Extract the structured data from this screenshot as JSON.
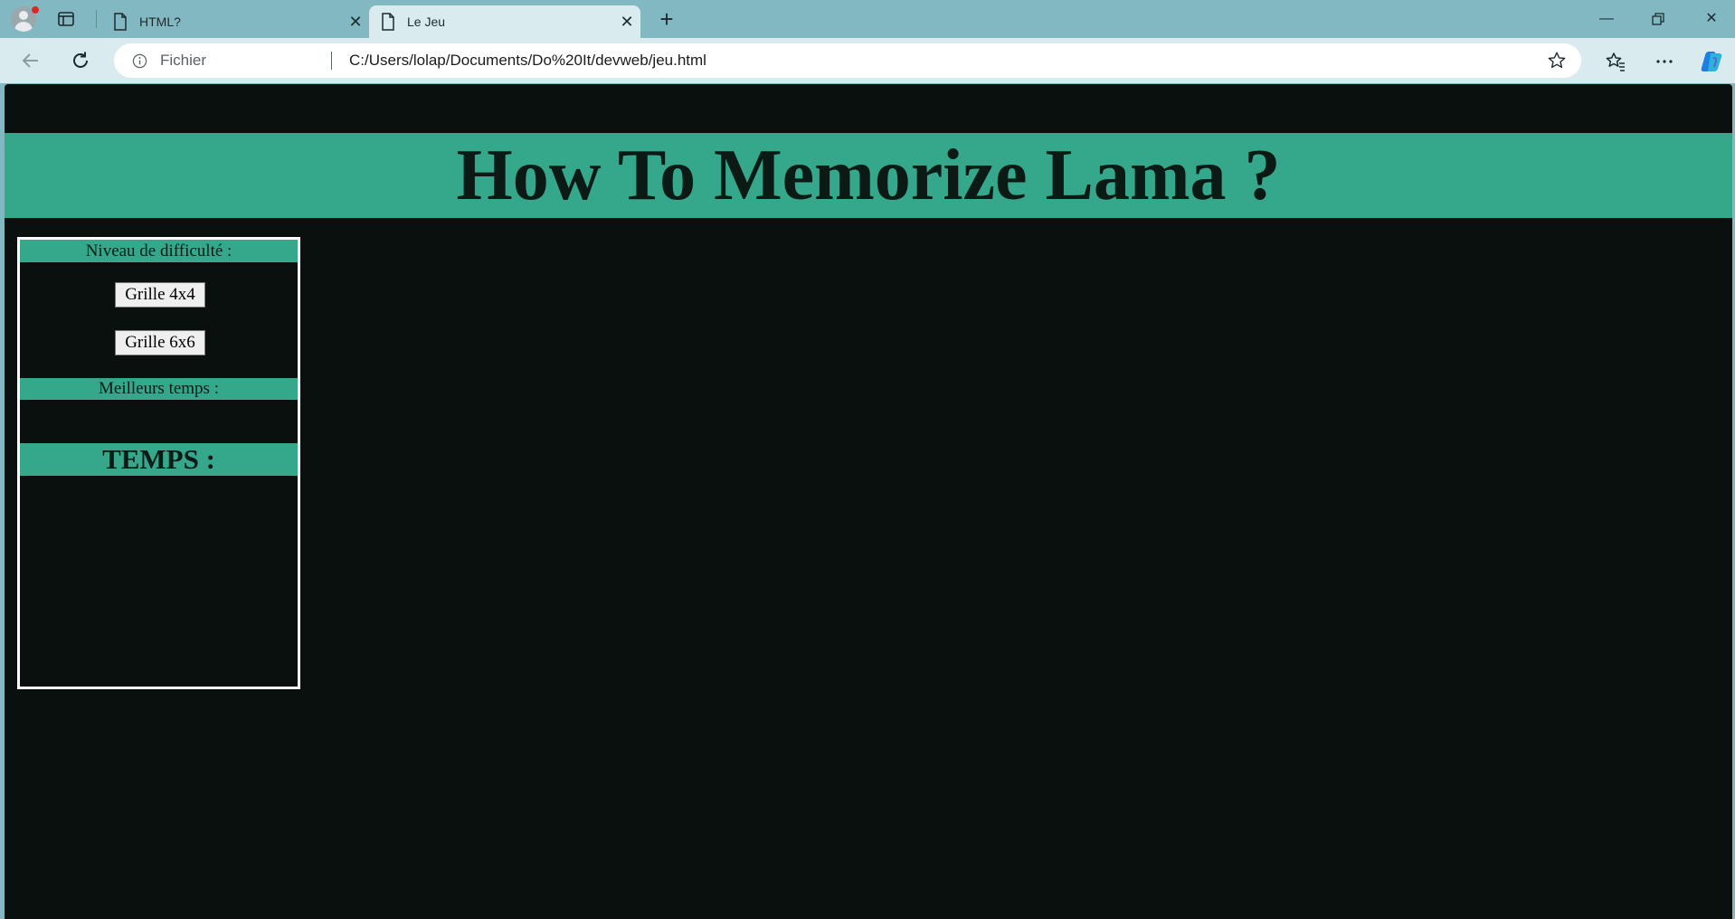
{
  "browser": {
    "tabs": [
      {
        "title": "HTML?",
        "active": false
      },
      {
        "title": "Le Jeu",
        "active": true
      }
    ],
    "address": {
      "scheme_label": "Fichier",
      "url": "C:/Users/lolap/Documents/Do%20It/devweb/jeu.html"
    },
    "icons": {
      "profile": "profile-avatar-icon",
      "tab_actions": "tab-actions-icon",
      "page": "page-icon",
      "close": "close-icon",
      "new_tab": "plus-icon",
      "back": "back-arrow-icon",
      "refresh": "refresh-icon",
      "info": "info-icon",
      "favorite": "star-icon",
      "favorites": "favorites-icon",
      "more": "more-icon",
      "copilot": "copilot-icon"
    }
  },
  "page": {
    "title": "How To Memorize Lama ?",
    "difficulty_heading": "Niveau de difficulté :",
    "buttons": {
      "grid4": "Grille 4x4",
      "grid6": "Grille 6x6"
    },
    "best_times_heading": "Meilleurs temps :",
    "time_heading": "TEMPS :"
  },
  "colors": {
    "accent": "#35a78b",
    "page_background": "#0a100e",
    "chrome": "#82b8c1"
  }
}
